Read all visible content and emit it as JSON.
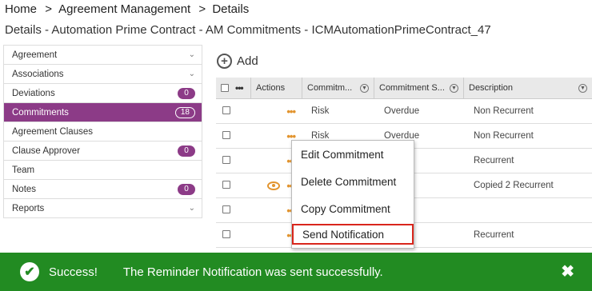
{
  "breadcrumb": {
    "items": [
      "Home",
      "Agreement Management",
      "Details"
    ],
    "separator": ">"
  },
  "page_title": "Details - Automation Prime Contract - AM Commitments - ICMAutomationPrimeContract_47",
  "sidebar": {
    "items": [
      {
        "label": "Agreement",
        "chevron": "⌄"
      },
      {
        "label": "Associations",
        "chevron": "⌄"
      },
      {
        "label": "Deviations",
        "badge": "0"
      },
      {
        "label": "Commitments",
        "badge": "18",
        "active": true
      },
      {
        "label": "Agreement Clauses"
      },
      {
        "label": "Clause Approver",
        "badge": "0"
      },
      {
        "label": "Team"
      },
      {
        "label": "Notes",
        "badge": "0"
      },
      {
        "label": "Reports",
        "chevron": "⌄"
      }
    ]
  },
  "add_button": {
    "label": "Add",
    "icon": "plus-circle-icon"
  },
  "grid": {
    "columns": [
      "Actions",
      "Commitm...",
      "Commitment S...",
      "Description"
    ],
    "rows": [
      {
        "commitment": "Risk",
        "status": "Overdue",
        "description": "Non Recurrent"
      },
      {
        "commitment": "Risk",
        "status": "Overdue",
        "description": "Non Recurrent"
      },
      {
        "commitment": "",
        "status": "e",
        "description": "Recurrent"
      },
      {
        "commitment": "",
        "status": "d",
        "description": "Copied 2 Recurrent",
        "has_eye": true
      },
      {
        "commitment": "",
        "status": "e",
        "description": ""
      },
      {
        "commitment": "",
        "status": "e",
        "description": "Recurrent"
      }
    ]
  },
  "context_menu": {
    "items": [
      "Edit Commitment",
      "Delete Commitment",
      "Copy Commitment",
      "Send Notification"
    ]
  },
  "toast": {
    "title": "Success!",
    "message": "The Reminder Notification was sent successfully.",
    "close": "✖",
    "check": "✔",
    "color": "#228b22"
  },
  "colors": {
    "accent": "#8c3b87",
    "action_orange": "#e2942e",
    "highlight_red": "#d9261c"
  }
}
